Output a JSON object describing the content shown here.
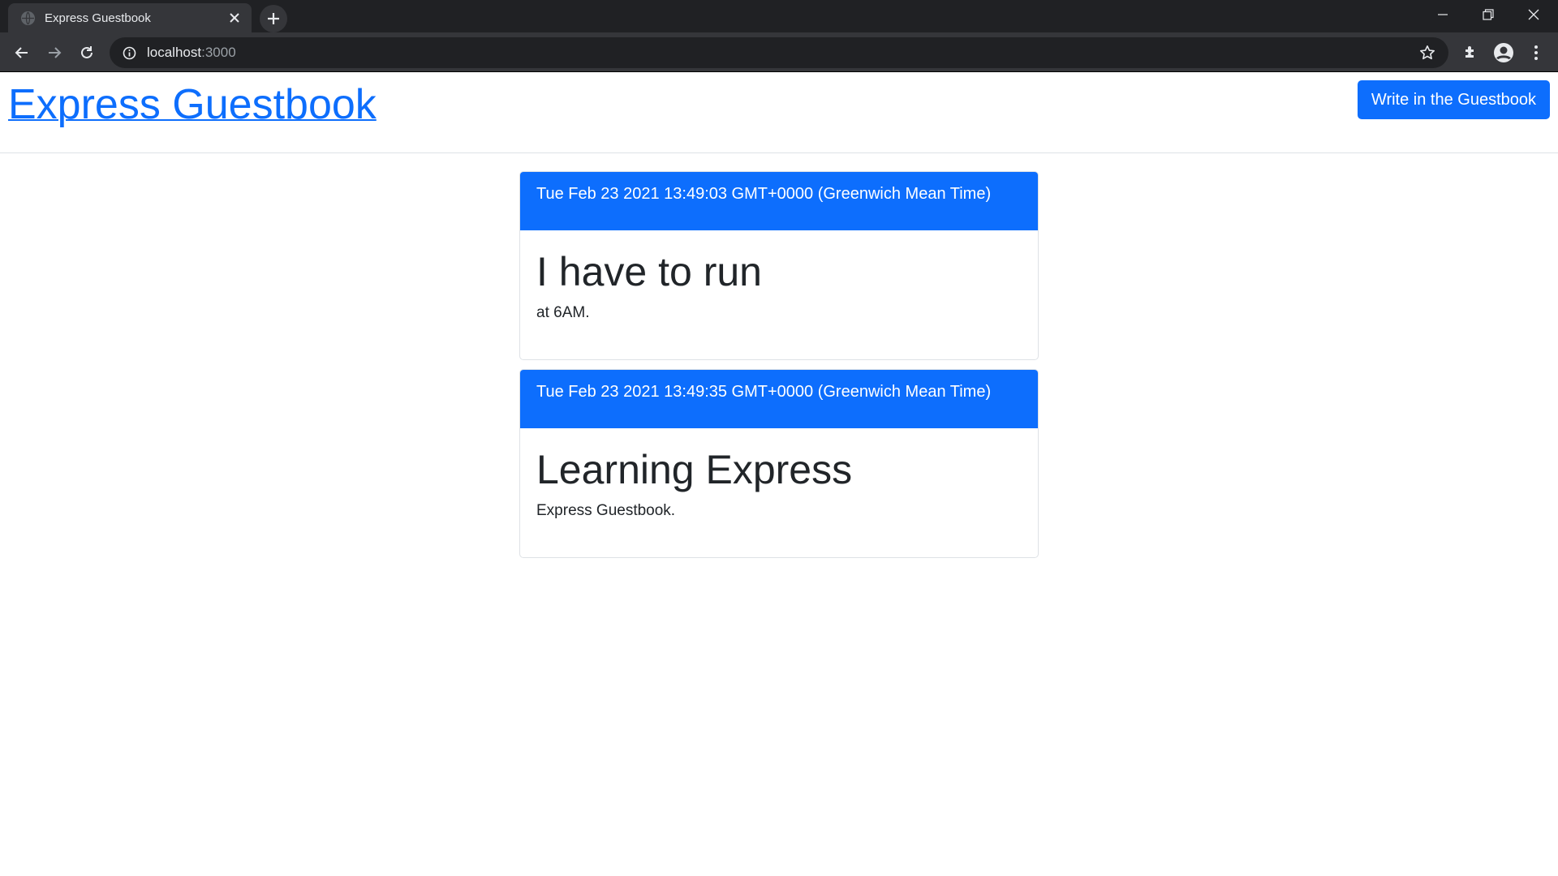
{
  "browser": {
    "tab_title": "Express Guestbook",
    "url_host": "localhost",
    "url_port": ":3000"
  },
  "header": {
    "brand": "Express Guestbook",
    "write_button": "Write in the Guestbook"
  },
  "entries": [
    {
      "timestamp": "Tue Feb 23 2021 13:49:03 GMT+0000 (Greenwich Mean Time)",
      "title": "I have to run",
      "body": "at 6AM."
    },
    {
      "timestamp": "Tue Feb 23 2021 13:49:35 GMT+0000 (Greenwich Mean Time)",
      "title": "Learning Express",
      "body": "Express Guestbook."
    }
  ],
  "colors": {
    "primary": "#0d6efd",
    "text": "#212529",
    "border": "#dee2e6"
  }
}
